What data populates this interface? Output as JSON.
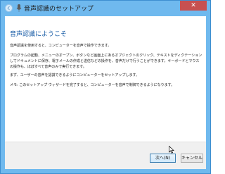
{
  "window": {
    "title": "音声認識のセットアップ",
    "close_label": "✕"
  },
  "content": {
    "heading": "音声認識にようこそ",
    "paragraphs": [
      "音声認識を使用すると、コンピューターを音声で操作できます。",
      "プログラムの起動、メニューのオープン、ボタンなど画面上にあるオブジェクトのクリック、テキストをディクテーションしてドキュメントに保存、電子メールの作成と送信などの操作を、音声だけで行うことができます。キーボードとマウスの操作も、ほぼすべて音声のみで実行できます。",
      "まず、ユーザーの音声を認識できるようにコンピューターをセットアップします。",
      "メモ: このセットアップ ウィザードを完了すると、コンピューターを音声で制御できるようになります。"
    ]
  },
  "footer": {
    "next_label": "次へ(N)",
    "cancel_label": "キャンセル"
  },
  "colors": {
    "frame": "#6fb9ee",
    "heading": "#1c5fa8",
    "close": "#c75050"
  }
}
